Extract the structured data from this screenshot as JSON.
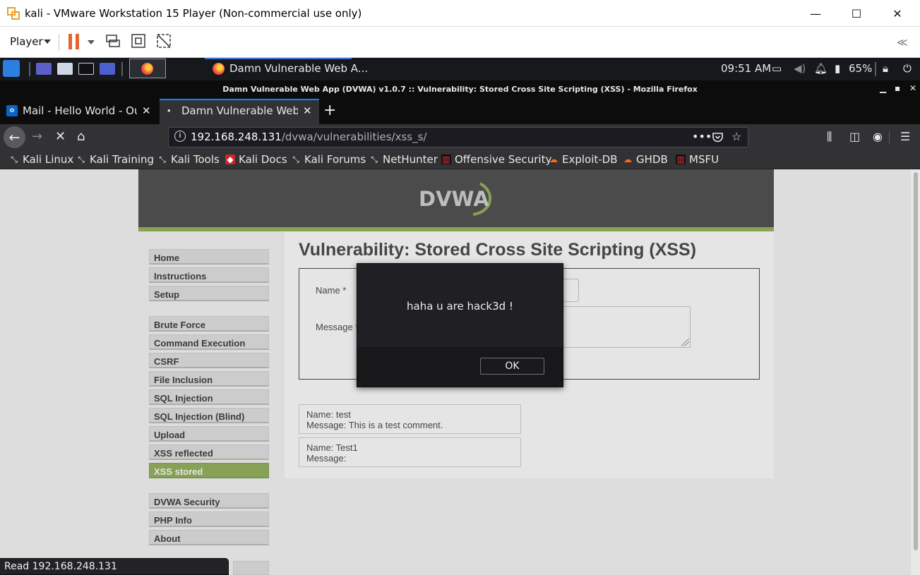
{
  "vmware": {
    "title": "kali - VMware Workstation 15 Player (Non-commercial use only)",
    "player_menu": "Player",
    "controls": {
      "minimize": "—",
      "maximize": "☐",
      "close": "✕"
    },
    "collapse_glyph": "≪"
  },
  "kali_panel": {
    "task_label": "Damn Vulnerable Web A...",
    "clock": "09:51 AM",
    "battery": "65%"
  },
  "firefox": {
    "window_title": "Damn Vulnerable Web App (DVWA) v1.0.7 :: Vulnerability: Stored Cross Site Scripting (XSS) - Mozilla Firefox",
    "tabs": [
      {
        "label": "Mail - Hello World - Outlook"
      },
      {
        "label": "Damn Vulnerable Web App"
      }
    ],
    "url_host": "192.168.248.131",
    "url_path": "/dvwa/vulnerabilities/xss_s/",
    "bookmarks": [
      {
        "label": "Kali Linux",
        "icon": "kali-dragon-icon"
      },
      {
        "label": "Kali Training",
        "icon": "kali-dragon-icon"
      },
      {
        "label": "Kali Tools",
        "icon": "kali-dragon-icon"
      },
      {
        "label": "Kali Docs",
        "icon": "kali-docs-icon"
      },
      {
        "label": "Kali Forums",
        "icon": "kali-dragon-icon"
      },
      {
        "label": "NetHunter",
        "icon": "kali-dragon-icon"
      },
      {
        "label": "Offensive Security",
        "icon": "offsec-icon"
      },
      {
        "label": "Exploit-DB",
        "icon": "exploitdb-icon"
      },
      {
        "label": "GHDB",
        "icon": "exploitdb-icon"
      },
      {
        "label": "MSFU",
        "icon": "offsec-icon"
      }
    ]
  },
  "dvwa": {
    "menu": [
      {
        "label": "Home"
      },
      {
        "label": "Instructions"
      },
      {
        "label": "Setup"
      },
      {
        "label": "Brute Force"
      },
      {
        "label": "Command Execution"
      },
      {
        "label": "CSRF"
      },
      {
        "label": "File Inclusion"
      },
      {
        "label": "SQL Injection"
      },
      {
        "label": "SQL Injection (Blind)"
      },
      {
        "label": "Upload"
      },
      {
        "label": "XSS reflected"
      },
      {
        "label": "XSS stored"
      },
      {
        "label": "DVWA Security"
      },
      {
        "label": "PHP Info"
      },
      {
        "label": "About"
      }
    ],
    "title": "Vulnerability: Stored Cross Site Scripting (XSS)",
    "form": {
      "name_label": "Name *",
      "message_label": "Message *"
    },
    "comments": [
      {
        "name": "Name: test",
        "message": "Message: This is a test comment."
      },
      {
        "name": "Name: Test1",
        "message": "Message:"
      }
    ]
  },
  "alert": {
    "message": "haha u are hack3d !",
    "ok_label": "OK"
  },
  "status_text": "Read 192.168.248.131",
  "colors": {
    "dvwa_green": "#7da23b",
    "firefox_accent": "#0a84ff",
    "pause_orange": "#e8632b"
  }
}
